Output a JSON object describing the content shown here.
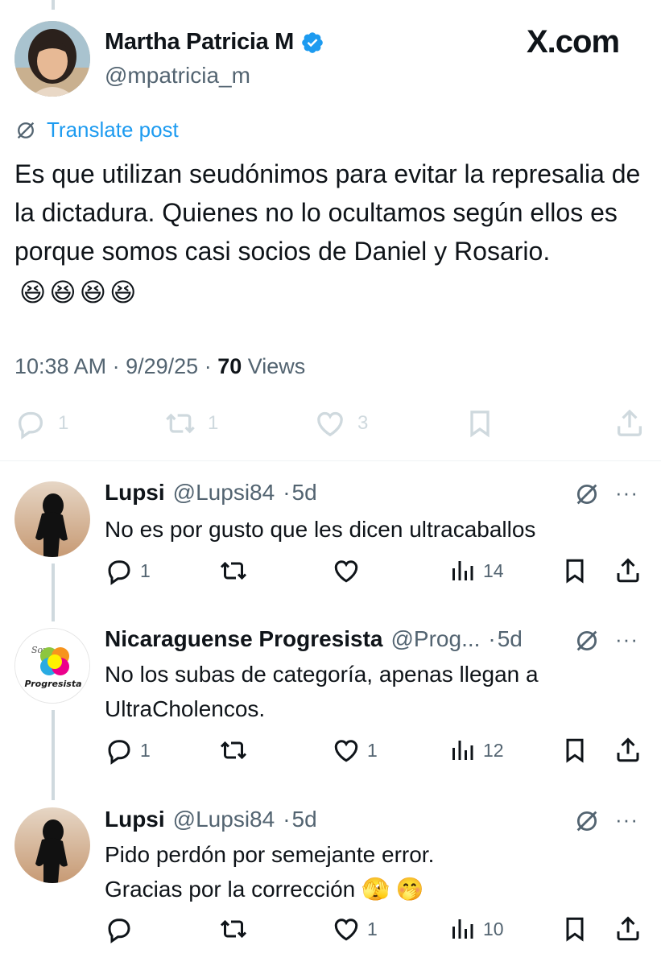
{
  "site_label": "X.com",
  "post": {
    "author_name": "Martha Patricia M",
    "author_handle": "@mpatricia_m",
    "translate_label": "Translate post",
    "text": "Es que utilizan seudónimos para evitar la represalia de la dictadura. Quienes no lo ocultamos según ellos es porque somos casi socios de Daniel y Rosario.",
    "emojis": [
      "😆",
      "😆",
      "😆",
      "😆"
    ],
    "time": "10:38 AM",
    "date": "9/29/25",
    "views_count": "70",
    "views_label": "Views",
    "replies": "1",
    "reposts": "1",
    "likes": "3"
  },
  "replies": [
    {
      "name": "Lupsi",
      "handle": "@Lupsi84",
      "age": "5d",
      "text": "No es por gusto que les dicen ultracaballos",
      "replies": "1",
      "reposts": "",
      "likes": "",
      "views": "14"
    },
    {
      "name": "Nicaraguense Progresista",
      "handle": "@Prog...",
      "age": "5d",
      "avatar_top_text": "Soy",
      "avatar_text": "Progresista",
      "text_line1": "No los subas de categoría, apenas llegan a",
      "text_line2": "UltraCholencos.",
      "replies": "1",
      "reposts": "",
      "likes": "1",
      "views": "12"
    },
    {
      "name": "Lupsi",
      "handle": "@Lupsi84",
      "age": "5d",
      "text_line1": "Pido perdón por semejante error.",
      "text_line2": "Gracias por la corrección",
      "emojis": [
        "🫣",
        "🤭"
      ],
      "replies": "",
      "reposts": "",
      "likes": "1",
      "views": "10"
    }
  ],
  "colors": {
    "accent": "#1d9bf0",
    "secondary_text": "#536471",
    "muted_icon": "#cfd9de"
  }
}
